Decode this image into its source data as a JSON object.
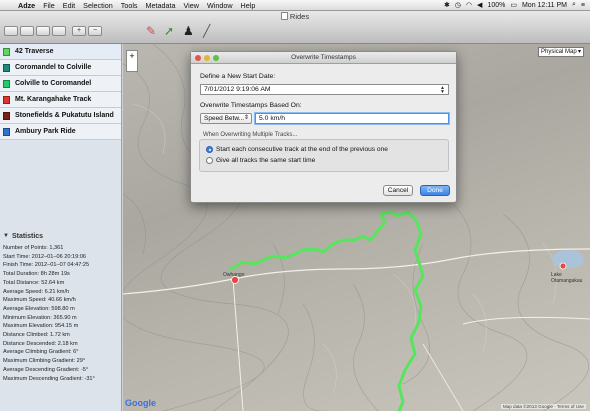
{
  "menubar": {
    "app_name": "Adze",
    "menus": [
      "File",
      "Edit",
      "Selection",
      "Tools",
      "Metadata",
      "View",
      "Window",
      "Help"
    ],
    "battery": "100%",
    "clock": "Mon 12:11 PM"
  },
  "window": {
    "title": "Rides",
    "toolbar_buttons": [
      "+",
      "−"
    ]
  },
  "tracks": [
    {
      "name": "42 Traverse",
      "color": "#5dd85d"
    },
    {
      "name": "Coromandel to Colville",
      "color": "#1f8a77"
    },
    {
      "name": "Colville to Coromandel",
      "color": "#1ed06d"
    },
    {
      "name": "Mt. Karangahake Track",
      "color": "#e0312b"
    },
    {
      "name": "Stonefields & Pukatutu Island",
      "color": "#7a1f1a"
    },
    {
      "name": "Ambury Park Ride",
      "color": "#2f73cf"
    }
  ],
  "statistics": {
    "header": "Statistics",
    "rows": [
      "Number of Points: 1,361",
      "Start Time: 2012–01–06 20:19:06",
      "Finish Time: 2012–01–07 04:47:25",
      "Total Duration: 8h 28m 19s",
      "Total Distance: 52.64 km",
      "Average Speed: 6.21 km/h",
      "Maximum Speed: 40.66 km/h",
      "Average Elevation: 598.80 m",
      "Minimum Elevation: 365.90 m",
      "Maximum Elevation: 954.15 m",
      "Distance Climbed: 1.72 km",
      "Distance Descended: 2.18 km",
      "Average Climbing Gradient: 6°",
      "Maximum Climbing Gradient: 29°",
      "Average Descending Gradient: -5°",
      "Maximum Descending Gradient: -31°"
    ]
  },
  "map": {
    "type_selector": "Physical Map",
    "zoom_label": "+",
    "labels": [
      "Owhango",
      "Lake Otamangakau"
    ],
    "google_logo": "Google",
    "attribution": "Map data ©2013 Google · Terms of Use"
  },
  "dialog": {
    "title": "Overwrite Timestamps",
    "start_date_label": "Define a New Start Date:",
    "start_date_value": "7/01/2012   9:19:06 AM",
    "based_on_label": "Overwrite Timestamps Based On:",
    "based_on_option": "Speed Betw...",
    "speed_value": "5.0 km/h",
    "multi_label": "When Overwriting Multiple Tracks...",
    "radio_options": [
      "Start each consecutive track at the end of the previous one",
      "Give all tracks the same start time"
    ],
    "cancel_label": "Cancel",
    "done_label": "Done"
  }
}
